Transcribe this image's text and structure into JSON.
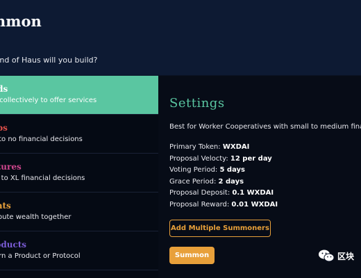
{
  "header": {
    "title": "mmon",
    "prompt": "kind of Haus will you build?"
  },
  "options": [
    {
      "title": "ilds",
      "desc": "rk collectively to offer services",
      "color": "#ffffff",
      "selected": true
    },
    {
      "title": "ubs",
      "desc": "le to no financial decisions",
      "color": "#e0504a",
      "selected": false
    },
    {
      "title": "ntures",
      "desc": "ge to XL financial decisions",
      "color": "#d0468e",
      "selected": false
    },
    {
      "title": "ants",
      "desc": "tribute wealth together",
      "color": "#e8a03a",
      "selected": false
    },
    {
      "title": "roducts",
      "desc": "vern a Product or Protocol",
      "color": "#7b5cd6",
      "selected": false
    }
  ],
  "settings": {
    "title": "Settings",
    "summary": "Best for Worker Cooperatives with small to medium financ",
    "details": [
      {
        "label": "Primary Token: ",
        "value": "WXDAI"
      },
      {
        "label": "Proposal Velocty: ",
        "value": "12 per day"
      },
      {
        "label": "Voting Period: ",
        "value": "5 days"
      },
      {
        "label": "Grace Period: ",
        "value": "2 days"
      },
      {
        "label": "Proposal Deposit: ",
        "value": "0.1 WXDAI"
      },
      {
        "label": "Proposal Reward: ",
        "value": "0.01 WXDAI"
      }
    ],
    "add_button": "Add Multiple Summoners",
    "summon_button": "Summon"
  },
  "watermark": {
    "text": "区块",
    "icon": "wechat-icon"
  },
  "colors": {
    "background": "#0b1326",
    "accent_green": "#5ac6a1",
    "accent_orange": "#e8a03a"
  }
}
